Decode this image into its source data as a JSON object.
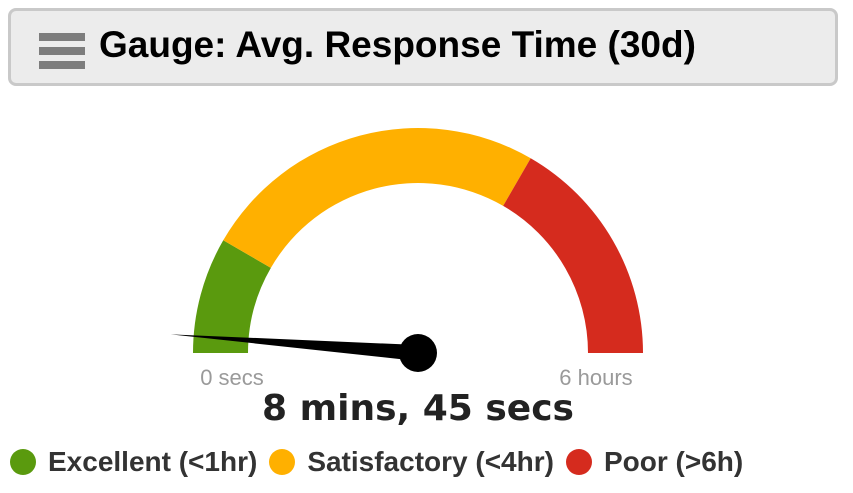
{
  "header": {
    "menu_icon": "hamburger-menu-icon",
    "title": "Gauge: Avg. Response Time (30d)"
  },
  "gauge": {
    "min_label": "0 secs",
    "max_label": "6 hours",
    "value_label": "8 mins, 45 secs",
    "value_fraction": 0.024,
    "bands": [
      {
        "name": "excellent",
        "from": 0.0,
        "to": 0.167,
        "color": "#5a9a0e"
      },
      {
        "name": "satisfactory",
        "from": 0.167,
        "to": 0.667,
        "color": "#ffb000"
      },
      {
        "name": "poor",
        "from": 0.667,
        "to": 1.0,
        "color": "#d52b1e"
      }
    ],
    "needle_color": "#000000"
  },
  "legend": {
    "items": [
      {
        "label": "Excellent (<1hr)",
        "color": "#5a9a0e"
      },
      {
        "label": "Satisfactory (<4hr)",
        "color": "#ffb000"
      },
      {
        "label": "Poor (>6h)",
        "color": "#d52b1e"
      }
    ]
  }
}
